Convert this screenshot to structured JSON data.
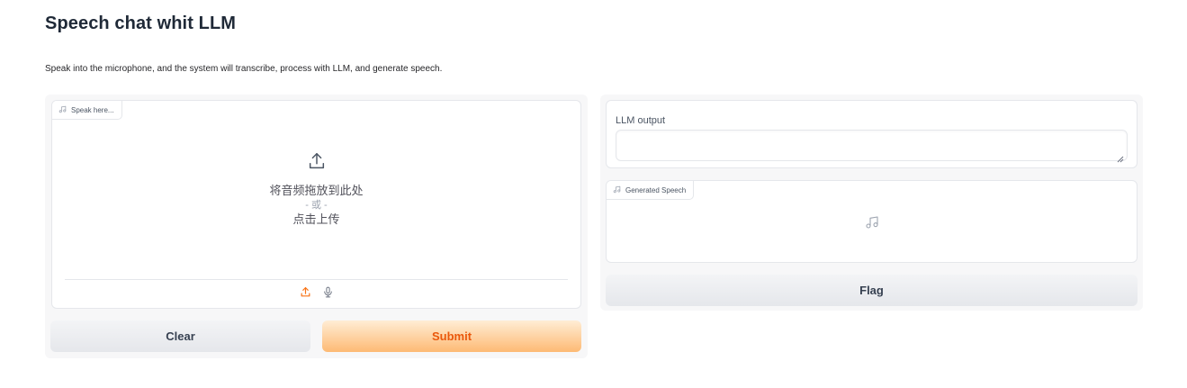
{
  "header": {
    "title": "Speech chat whit LLM",
    "description": "Speak into the microphone, and the system will transcribe, process with LLM, and generate speech."
  },
  "input_audio": {
    "label": "Speak here...",
    "drop_text": "将音频拖放到此处",
    "or_text": "- 或 -",
    "click_text": "点击上传",
    "icons": [
      "music-note-icon",
      "upload-icon",
      "microphone-icon"
    ]
  },
  "buttons": {
    "clear": "Clear",
    "submit": "Submit",
    "flag": "Flag"
  },
  "llm_output": {
    "label": "LLM output",
    "value": ""
  },
  "generated_speech": {
    "label": "Generated Speech"
  },
  "colors": {
    "accent": "#ea580c",
    "primary_gradient_start": "#ffedd5",
    "primary_gradient_end": "#fdba74",
    "border": "#e5e7eb"
  }
}
